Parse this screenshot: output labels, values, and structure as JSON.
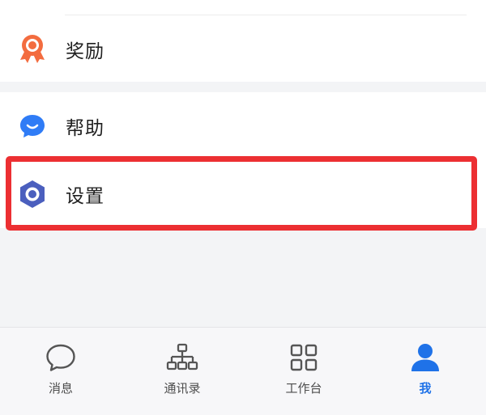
{
  "menu": {
    "reward": {
      "label": "奖励",
      "icon": "award-medal-icon"
    },
    "help": {
      "label": "帮助",
      "icon": "chat-bubble-smile-icon"
    },
    "settings": {
      "label": "设置",
      "icon": "hexagon-gear-icon"
    }
  },
  "highlight": {
    "target": "settings",
    "color": "#ec2f32"
  },
  "tabbar": {
    "active_index": 3,
    "tabs": [
      {
        "label": "消息",
        "icon": "message-bubble-icon"
      },
      {
        "label": "通讯录",
        "icon": "org-chart-icon"
      },
      {
        "label": "工作台",
        "icon": "grid-apps-icon"
      },
      {
        "label": "我",
        "icon": "person-icon"
      }
    ]
  },
  "colors": {
    "accent": "#1f72e8",
    "award_orange": "#f36c3f",
    "help_blue": "#2f7cf6",
    "settings_indigo": "#4b5fbe",
    "background": "#f3f4f6"
  }
}
